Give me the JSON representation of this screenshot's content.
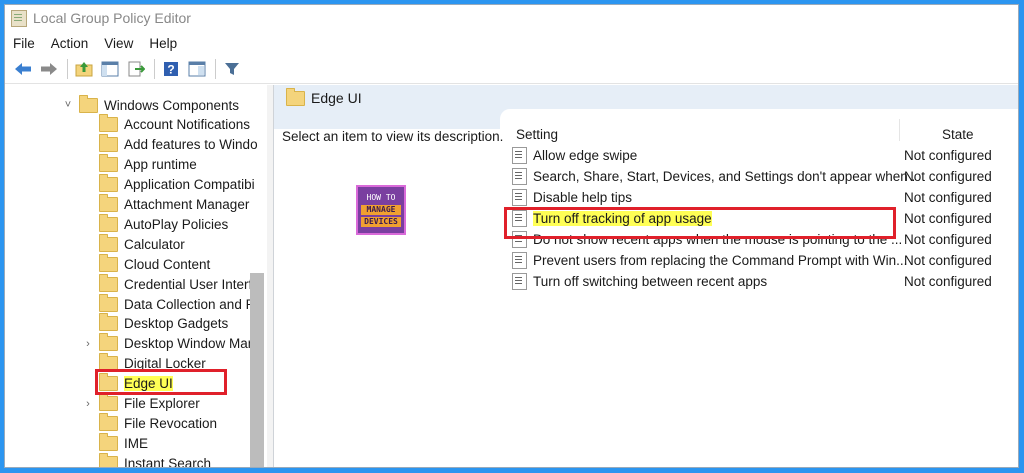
{
  "window": {
    "title": "Local Group Policy Editor"
  },
  "menu": [
    "File",
    "Action",
    "View",
    "Help"
  ],
  "toolbar_icons": [
    "back-arrow-icon",
    "forward-arrow-icon",
    "up-folder-icon",
    "show-hide-tree-icon",
    "export-list-icon",
    "help-icon",
    "properties-icon",
    "filter-icon"
  ],
  "tree": [
    {
      "label": "Windows Components",
      "expander": "expanded"
    },
    {
      "label": "Account Notifications",
      "expander": ""
    },
    {
      "label": "Add features to Windo",
      "expander": ""
    },
    {
      "label": "App runtime",
      "expander": ""
    },
    {
      "label": "Application Compatibi",
      "expander": ""
    },
    {
      "label": "Attachment Manager",
      "expander": ""
    },
    {
      "label": "AutoPlay Policies",
      "expander": ""
    },
    {
      "label": "Calculator",
      "expander": ""
    },
    {
      "label": "Cloud Content",
      "expander": ""
    },
    {
      "label": "Credential User Interfa",
      "expander": ""
    },
    {
      "label": "Data Collection and Pr",
      "expander": ""
    },
    {
      "label": "Desktop Gadgets",
      "expander": ""
    },
    {
      "label": "Desktop Window Man",
      "expander": "collapsed"
    },
    {
      "label": "Digital Locker",
      "expander": ""
    },
    {
      "label": "Edge UI",
      "expander": "",
      "selected": true
    },
    {
      "label": "File Explorer",
      "expander": "collapsed"
    },
    {
      "label": "File Revocation",
      "expander": ""
    },
    {
      "label": "IME",
      "expander": ""
    },
    {
      "label": "Instant Search",
      "expander": ""
    }
  ],
  "details": {
    "header": "Edge UI",
    "description_prompt": "Select an item to view its description.",
    "columns": {
      "setting": "Setting",
      "state": "State"
    },
    "logo": {
      "line1": "HOW TO",
      "line2": "MANAGE",
      "line3": "DEVICES"
    },
    "policies": [
      {
        "name": "Allow edge swipe",
        "state": "Not configured"
      },
      {
        "name": "Search, Share, Start, Devices, and Settings don't appear when ...",
        "state": "Not configured"
      },
      {
        "name": "Disable help tips",
        "state": "Not configured"
      },
      {
        "name": "Turn off tracking of app usage",
        "state": "Not configured",
        "highlighted": true
      },
      {
        "name": "Do not show recent apps when the mouse is pointing to the ...",
        "state": "Not configured"
      },
      {
        "name": "Prevent users from replacing the Command Prompt with Win...",
        "state": "Not configured"
      },
      {
        "name": "Turn off switching between recent apps",
        "state": "Not configured"
      }
    ]
  },
  "colors": {
    "frame": "#2b95f0",
    "highlight": "#ffff55",
    "callout": "#e0202a"
  }
}
